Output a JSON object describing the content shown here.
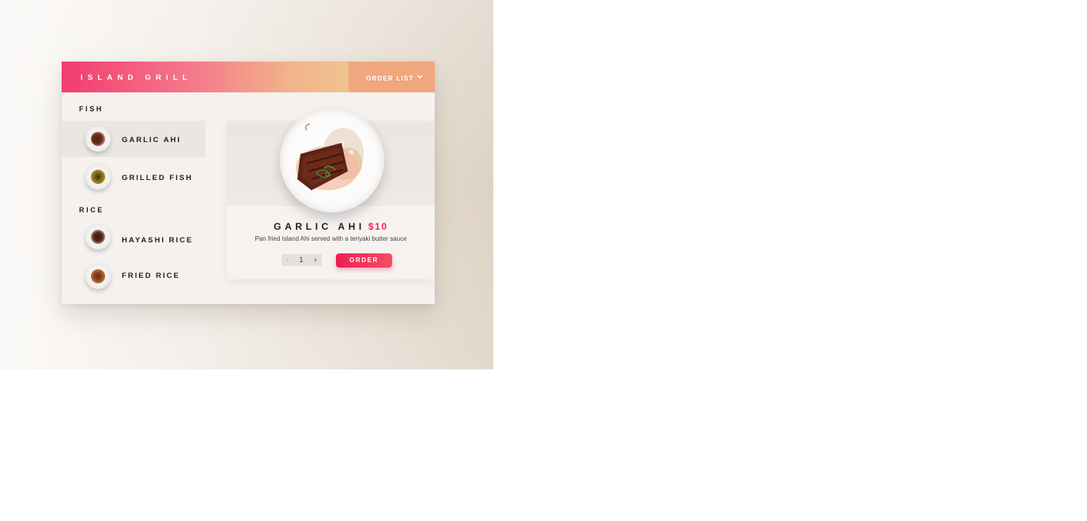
{
  "header": {
    "brand": "ISLAND GRILL",
    "order_list_label": "ORDER LIST",
    "order_list_icon": "chevron-down-icon"
  },
  "menu": {
    "sections": [
      {
        "title": "FISH",
        "items": [
          {
            "label": "GARLIC AHI",
            "active": true
          },
          {
            "label": "GRILLED FISH",
            "active": false
          }
        ]
      },
      {
        "title": "RICE",
        "items": [
          {
            "label": "HAYASHI RICE",
            "active": false
          },
          {
            "label": "FRIED RICE",
            "active": false
          }
        ]
      }
    ]
  },
  "detail": {
    "name": "GARLIC AHI",
    "price": "$10",
    "description": "Pan fried Island Ahi served with a teriyaki butter sauce",
    "quantity": "1",
    "decrement_icon": "chevron-left-icon",
    "increment_icon": "chevron-right-icon",
    "order_label": "ORDER"
  },
  "colors": {
    "accent": "#ec2857",
    "gradient_start": "#f23c6f",
    "gradient_end": "#f0c28e",
    "order_bar": "#f1a77e"
  }
}
